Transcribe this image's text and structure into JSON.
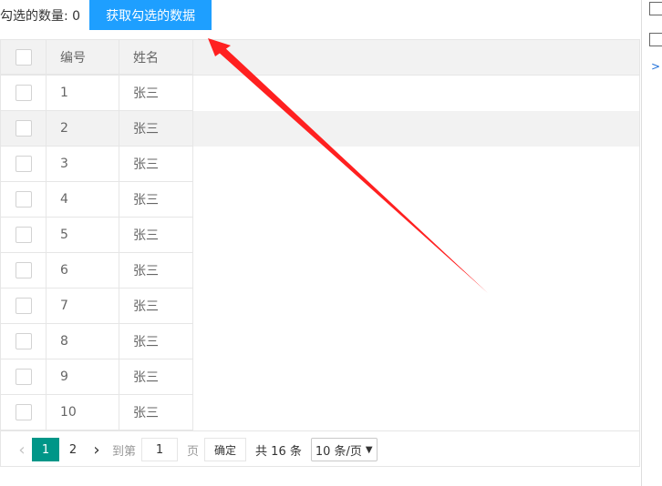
{
  "toolbar": {
    "count_label": "勾选的数量: ",
    "count_value": "0",
    "get_button": "获取勾选的数据"
  },
  "table": {
    "columns": [
      "编号",
      "姓名"
    ],
    "rows": [
      {
        "id": "1",
        "name": "张三"
      },
      {
        "id": "2",
        "name": "张三"
      },
      {
        "id": "3",
        "name": "张三"
      },
      {
        "id": "4",
        "name": "张三"
      },
      {
        "id": "5",
        "name": "张三"
      },
      {
        "id": "6",
        "name": "张三"
      },
      {
        "id": "7",
        "name": "张三"
      },
      {
        "id": "8",
        "name": "张三"
      },
      {
        "id": "9",
        "name": "张三"
      },
      {
        "id": "10",
        "name": "张三"
      }
    ],
    "highlighted_row": 1
  },
  "pager": {
    "prev": "‹",
    "pages": [
      "1",
      "2"
    ],
    "current": "1",
    "next": "›",
    "goto_prefix": "到第",
    "goto_value": "1",
    "goto_suffix": "页",
    "confirm": "确定",
    "total": "共 16 条",
    "page_size": "10 条/页"
  },
  "colors": {
    "primary_button": "#1e9fff",
    "current_page": "#009688",
    "annotation_arrow": "#ff2020"
  }
}
